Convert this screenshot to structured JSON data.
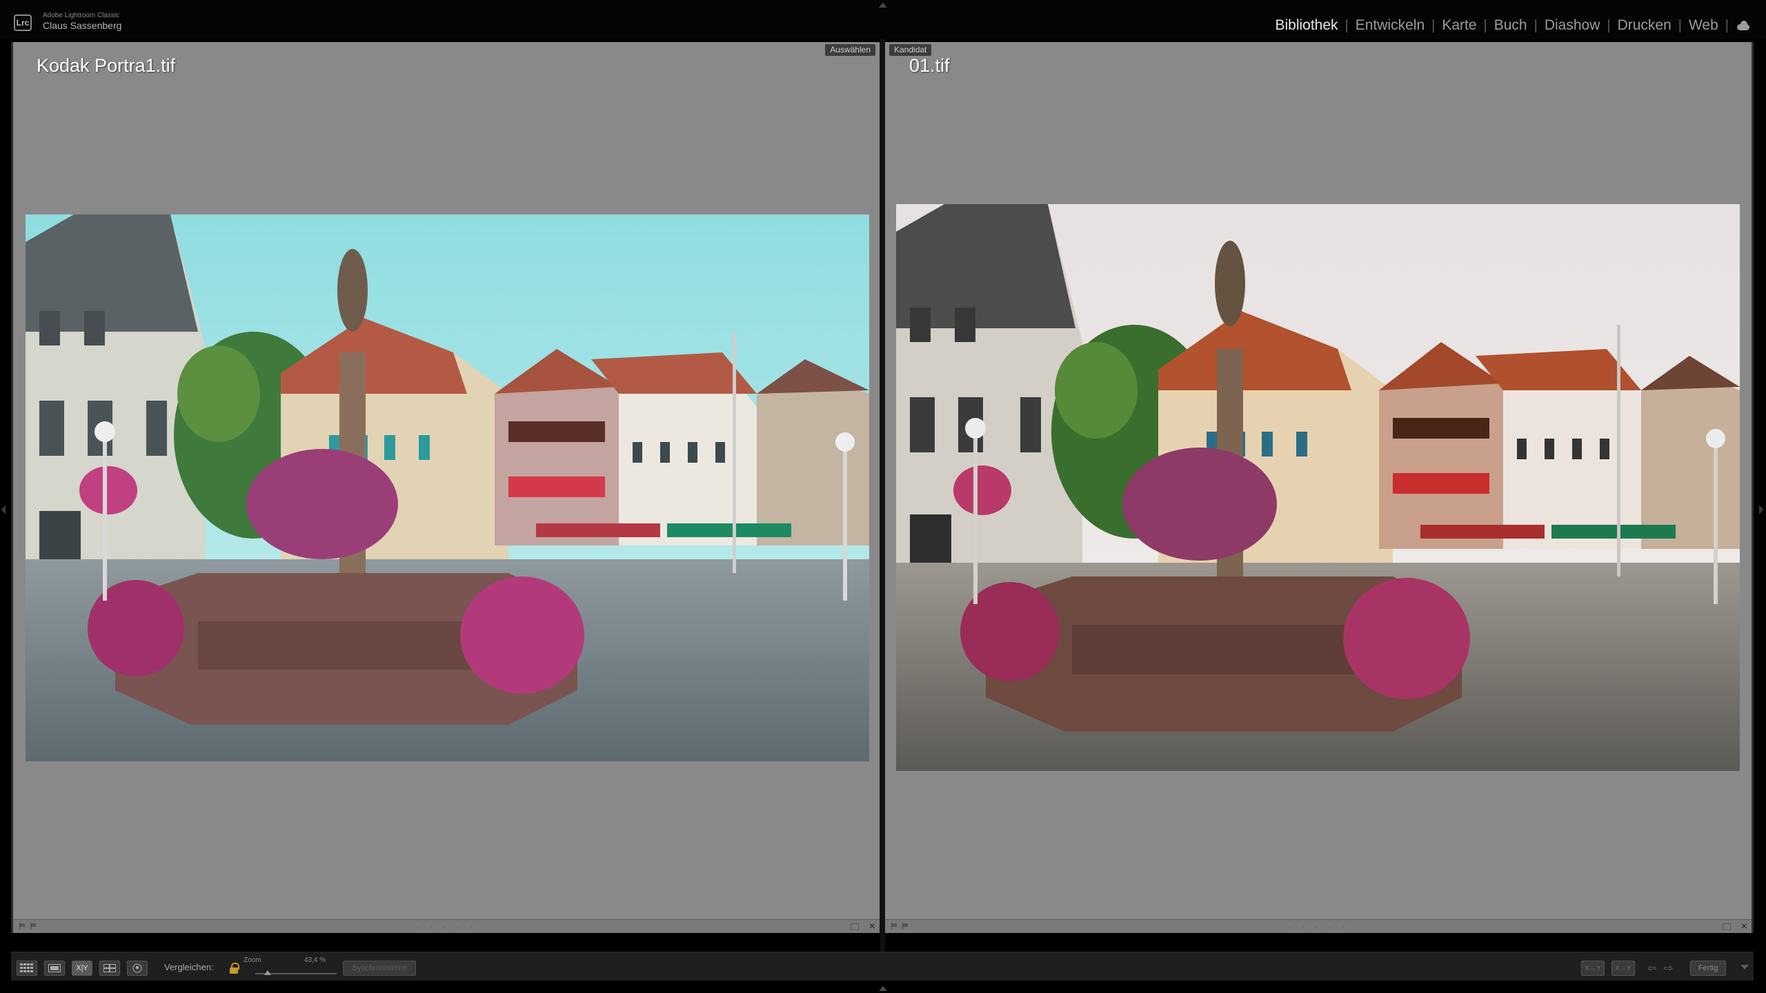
{
  "app": {
    "badge": "Lrc",
    "name": "Adobe Lightroom Classic",
    "user": "Claus Sassenberg"
  },
  "modules": [
    {
      "label": "Bibliothek",
      "active": true
    },
    {
      "label": "Entwickeln",
      "active": false
    },
    {
      "label": "Karte",
      "active": false
    },
    {
      "label": "Buch",
      "active": false
    },
    {
      "label": "Diashow",
      "active": false
    },
    {
      "label": "Drucken",
      "active": false
    },
    {
      "label": "Web",
      "active": false
    }
  ],
  "separator": "|",
  "left_panel": {
    "tag": "Auswählen",
    "filename": "Kodak Portra1.tif",
    "rating_dots": "· · · · ·",
    "close": "×"
  },
  "right_panel": {
    "tag": "Kandidat",
    "filename": "01.tif",
    "rating_dots": "· · · · ·",
    "close": "×"
  },
  "toolbar": {
    "xy_label": "X|Y",
    "compare_label": "Vergleichen:",
    "zoom_label": "Zoom",
    "zoom_value": "43,4 %",
    "zoom_fraction": 0.15,
    "sync_label": "Synchronisieren",
    "swap_label": "X↔Y",
    "make_label": "X→Y",
    "prev_arrow": "⇦",
    "next_arrow": "⇨",
    "done_label": "Fertig"
  },
  "colors": {
    "panel_bg": "#898989",
    "app_bg": "#000000",
    "active_module": "#e8e8e8",
    "inactive_module": "#9c9c9c",
    "lock": "#c69a2a"
  }
}
